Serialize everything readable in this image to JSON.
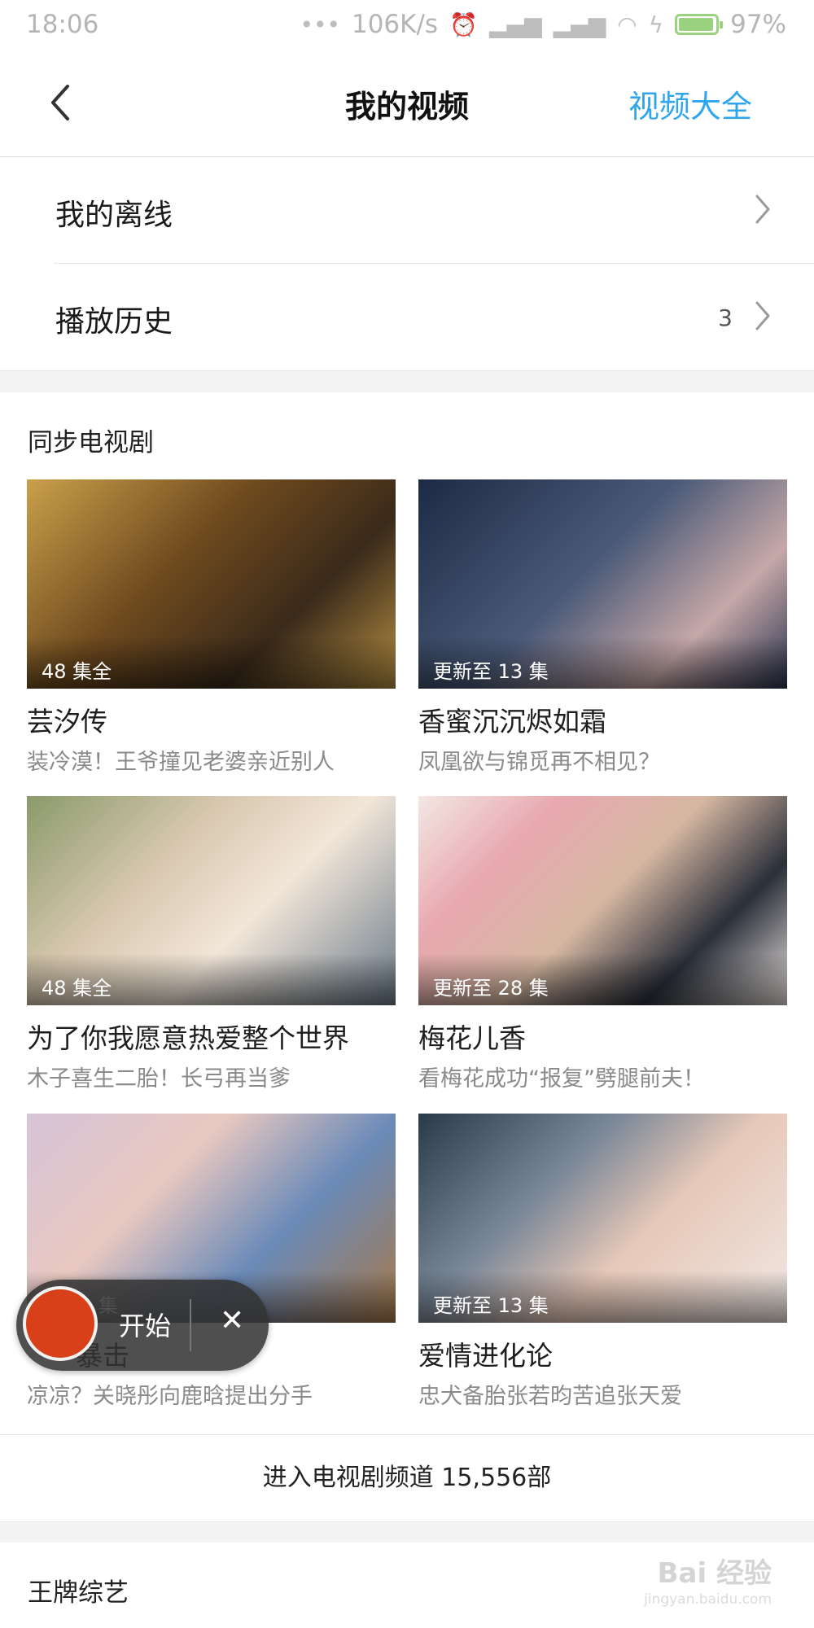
{
  "status_bar": {
    "time": "18:06",
    "net_speed": "106K/s",
    "battery": "97%",
    "icons": [
      "more-dots-icon",
      "alarm-icon",
      "signal-icon",
      "signal-icon",
      "wifi-icon",
      "charging-icon",
      "battery-icon"
    ]
  },
  "header": {
    "title": "我的视频",
    "right_link": "视频大全",
    "back_icon": "chevron-left-icon",
    "accent_color": "#2fa6ec"
  },
  "menu": {
    "offline_label": "我的离线",
    "history_label": "播放历史",
    "history_count": "3"
  },
  "tv_section": {
    "title": "同步电视剧",
    "cards": [
      {
        "name": "芸汐传",
        "desc": "装冷漠！王爷撞见老婆亲近别人",
        "episodes": "48 集全"
      },
      {
        "name": "香蜜沉沉烬如霜",
        "desc": "凤凰欲与锦觅再不相见？",
        "episodes": "更新至 13 集"
      },
      {
        "name": "为了你我愿意热爱整个世界",
        "desc": "木子喜生二胎！长弓再当爹",
        "episodes": "48 集全"
      },
      {
        "name": "梅花儿香",
        "desc": "看梅花成功“报复”劈腿前夫！",
        "episodes": "更新至 28 集"
      },
      {
        "name": "暴击",
        "desc": "凉凉？关晓彤向鹿晗提出分手",
        "episodes": "至 30 集"
      },
      {
        "name": "爱情进化论",
        "desc": "忠犬备胎张若昀苦追张天爱",
        "episodes": "更新至 13 集"
      }
    ],
    "channel_button": "进入电视剧频道 15,556部"
  },
  "variety_section": {
    "title": "王牌综艺"
  },
  "recorder": {
    "start_label": "开始",
    "close_label": "✕"
  },
  "watermark": {
    "text": "Bai 经验",
    "sub": "jingyan.baidu.com"
  }
}
